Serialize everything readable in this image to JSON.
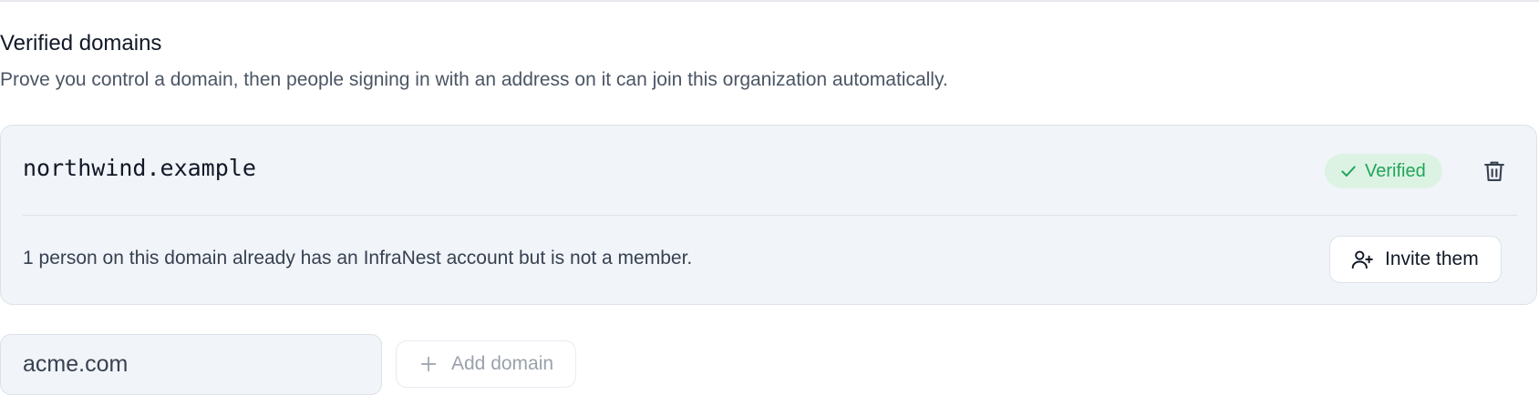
{
  "section": {
    "title": "Verified domains",
    "description": "Prove you control a domain, then people signing in with an address on it can join this organization automatically."
  },
  "domains": [
    {
      "name": "northwind.example",
      "status_label": "Verified",
      "status_icon": "check-icon",
      "delete_icon": "trash-icon",
      "notice": "1 person on this domain already has an InfraNest account but is not a member.",
      "invite_label": "Invite them",
      "invite_icon": "user-plus-icon"
    }
  ],
  "add_form": {
    "input_value": "acme.com",
    "button_label": "Add domain",
    "button_icon": "plus-icon"
  },
  "colors": {
    "card_bg": "#f1f4f8",
    "verified_bg": "#dcf3e4",
    "verified_text": "#22a558",
    "muted_text": "#9aa1ab"
  }
}
